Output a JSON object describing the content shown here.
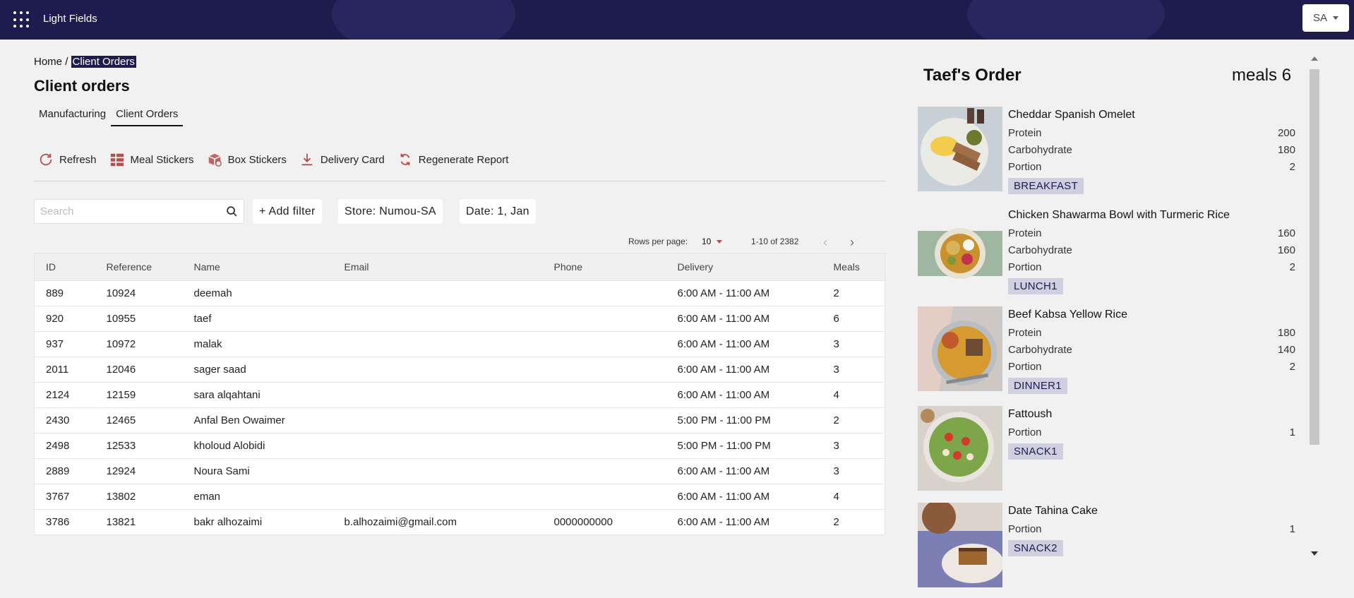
{
  "app": {
    "title": "Light Fields",
    "user_initials": "SA"
  },
  "breadcrumb": {
    "home": "Home",
    "separator": "/",
    "current": "Client Orders"
  },
  "page_title": "Client orders",
  "tabs": [
    {
      "label": "Manufacturing"
    },
    {
      "label": "Client Orders"
    }
  ],
  "toolbar": {
    "refresh": "Refresh",
    "meal_stickers": "Meal Stickers",
    "box_stickers": "Box Stickers",
    "delivery_card": "Delivery Card",
    "regenerate_report": "Regenerate Report"
  },
  "filters": {
    "search_placeholder": "Search",
    "add_filter": "+ Add filter",
    "store": "Store: Numou-SA",
    "date": "Date: 1, Jan"
  },
  "pagination": {
    "rows_per_page_label": "Rows per page:",
    "rows_per_page": "10",
    "range": "1-10 of 2382"
  },
  "table": {
    "headers": {
      "id": "ID",
      "reference": "Reference",
      "name": "Name",
      "email": "Email",
      "phone": "Phone",
      "delivery": "Delivery",
      "meals": "Meals"
    },
    "rows": [
      {
        "id": "889",
        "reference": "10924",
        "name": "deemah",
        "email": "",
        "phone": "",
        "delivery": "6:00 AM - 11:00 AM",
        "meals": "2"
      },
      {
        "id": "920",
        "reference": "10955",
        "name": "taef",
        "email": "",
        "phone": "",
        "delivery": "6:00 AM - 11:00 AM",
        "meals": "6"
      },
      {
        "id": "937",
        "reference": "10972",
        "name": "malak",
        "email": "",
        "phone": "",
        "delivery": "6:00 AM - 11:00 AM",
        "meals": "3"
      },
      {
        "id": "2011",
        "reference": "12046",
        "name": "sager saad",
        "email": "",
        "phone": "",
        "delivery": "6:00 AM - 11:00 AM",
        "meals": "3"
      },
      {
        "id": "2124",
        "reference": "12159",
        "name": "sara alqahtani",
        "email": "",
        "phone": "",
        "delivery": "6:00 AM - 11:00 AM",
        "meals": "4"
      },
      {
        "id": "2430",
        "reference": "12465",
        "name": "Anfal Ben Owaimer",
        "email": "",
        "phone": "",
        "delivery": "5:00 PM - 11:00 PM",
        "meals": "2"
      },
      {
        "id": "2498",
        "reference": "12533",
        "name": "kholoud Alobidi",
        "email": "",
        "phone": "",
        "delivery": "5:00 PM - 11:00 PM",
        "meals": "3"
      },
      {
        "id": "2889",
        "reference": "12924",
        "name": "Noura Sami",
        "email": "",
        "phone": "",
        "delivery": "6:00 AM - 11:00 AM",
        "meals": "3"
      },
      {
        "id": "3767",
        "reference": "13802",
        "name": "eman",
        "email": "",
        "phone": "",
        "delivery": "6:00 AM - 11:00 AM",
        "meals": "4"
      },
      {
        "id": "3786",
        "reference": "13821",
        "name": "bakr alhozaimi",
        "email": "b.alhozaimi@gmail.com",
        "phone": "0000000000",
        "delivery": "6:00 AM - 11:00 AM",
        "meals": "2"
      }
    ]
  },
  "order_panel": {
    "title": "Taef's Order",
    "meals_label": "meals 6",
    "meals": [
      {
        "name": "Cheddar Spanish Omelet",
        "nutrients": [
          {
            "label": "Protein",
            "value": "200"
          },
          {
            "label": "Carbohydrate",
            "value": "180"
          },
          {
            "label": "Portion",
            "value": "2"
          }
        ],
        "tag": "BREAKFAST",
        "image": "omelet-photo"
      },
      {
        "name": "Chicken Shawarma Bowl with Turmeric Rice",
        "nutrients": [
          {
            "label": "Protein",
            "value": "160"
          },
          {
            "label": "Carbohydrate",
            "value": "160"
          },
          {
            "label": "Portion",
            "value": "2"
          }
        ],
        "tag": "LUNCH1",
        "image": "shawarma-bowl-photo"
      },
      {
        "name": "Beef Kabsa Yellow Rice",
        "nutrients": [
          {
            "label": "Protein",
            "value": "180"
          },
          {
            "label": "Carbohydrate",
            "value": "140"
          },
          {
            "label": "Portion",
            "value": "2"
          }
        ],
        "tag": "DINNER1",
        "image": "kabsa-photo"
      },
      {
        "name": "Fattoush",
        "nutrients": [
          {
            "label": "Portion",
            "value": "1"
          }
        ],
        "tag": "SNACK1",
        "image": "fattoush-photo"
      },
      {
        "name": "Date Tahina Cake",
        "nutrients": [
          {
            "label": "Portion",
            "value": "1"
          }
        ],
        "tag": "SNACK2",
        "image": "cake-photo"
      }
    ]
  },
  "colors": {
    "nav_bg": "#1e1b4e",
    "tag_bg": "#cfcfdf",
    "icon_accent": "#b25050"
  }
}
